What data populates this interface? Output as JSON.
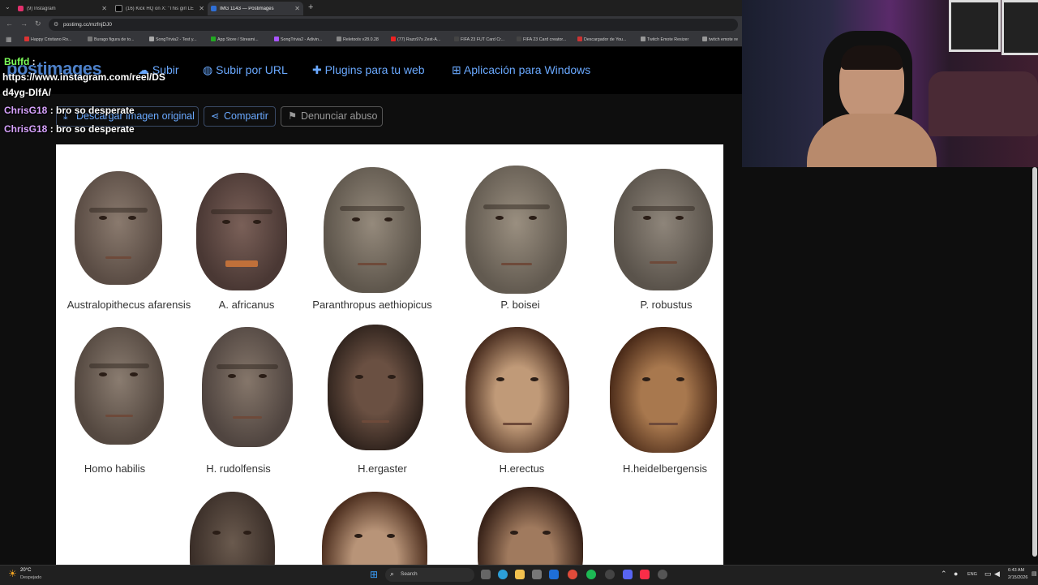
{
  "browser": {
    "tabs": [
      {
        "label": "(9) Instagram",
        "color": "#e1306c"
      },
      {
        "label": "(16) Kick HQ on X: \"This girl LE",
        "color": "#000000"
      },
      {
        "label": "IMG 1143 — Postimages",
        "color": "#2f6fd6"
      }
    ],
    "new_tab": "+",
    "url": "postimg.cc/mzfnjDJ0",
    "bookmarks": [
      "Happy Cristiano Ro...",
      "Burago figura de to...",
      "SongTrivia2 - Test y...",
      "App Store / Streami...",
      "SongTrivia2 - Adivin...",
      "Reletools v28.0.28",
      "(77) Razo97s Zest-A...",
      "FIFA 23 FUT Card Cr...",
      "FIFA 23 Card creator...",
      "Descargador de You...",
      "Twitch Emote Resizer",
      "twitch emote re"
    ]
  },
  "site": {
    "logo": "postimages",
    "nav": [
      "Subir",
      "Subir por URL",
      "Plugins para tu web",
      "Aplicación para Windows"
    ],
    "toolbar": [
      "Descargar imagen original",
      "Compartir",
      "Denunciar abuso"
    ]
  },
  "chat": {
    "lines": [
      {
        "user": "Buffd",
        "sep": " :",
        "text": ""
      },
      {
        "user": "",
        "sep": "",
        "text": "https://www.instagram.com/reel/DS"
      },
      {
        "user": "",
        "sep": "",
        "text": "d4yg-DlfA/"
      },
      {
        "user": "ChrisG18",
        "sep": " : ",
        "text": "bro so desperate"
      },
      {
        "user": "ChrisG18",
        "sep": " : ",
        "text": "bro so desperate"
      }
    ]
  },
  "image": {
    "row1": [
      "Australopithecus afarensis",
      "A. africanus",
      "Paranthropus aethiopicus",
      "P. boisei",
      "P. robustus"
    ],
    "row2": [
      "Homo habilis",
      "H. rudolfensis",
      "H.ergaster",
      "H.erectus",
      "H.heidelbergensis"
    ]
  },
  "taskbar": {
    "weather_temp": "20°C",
    "weather_desc": "Despejado",
    "search": "Search",
    "lang": "ENG",
    "time": "6:43 AM",
    "date": "2/15/2026"
  }
}
